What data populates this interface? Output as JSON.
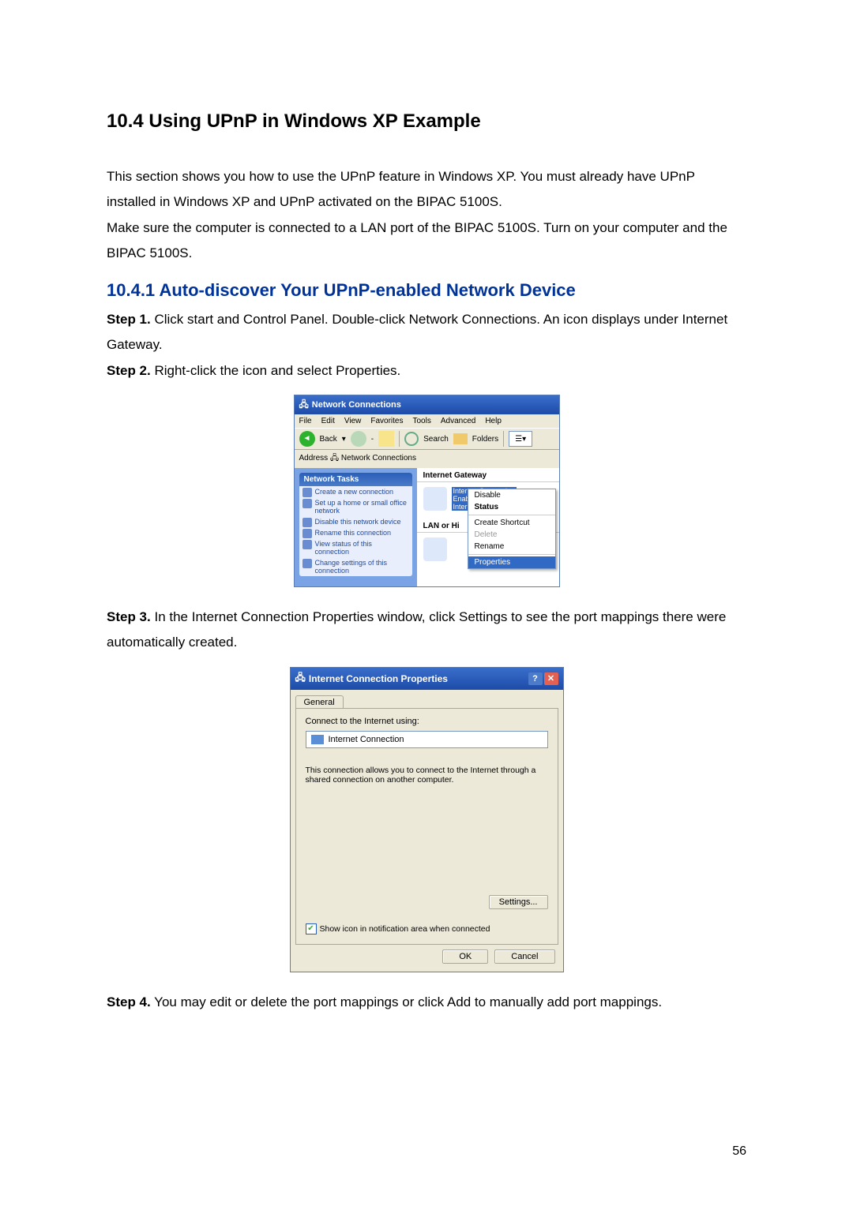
{
  "headings": {
    "h2": "10.4 Using UPnP in Windows XP Example",
    "h3": "10.4.1 Auto-discover Your UPnP-enabled Network Device"
  },
  "paragraphs": {
    "intro1": "This section shows you how to use the UPnP feature in Windows XP. You must already have UPnP installed in Windows XP and UPnP activated on the BIPAC 5100S.",
    "intro2": "Make sure the computer is connected to a LAN port of the BIPAC 5100S. Turn on your computer and the BIPAC 5100S."
  },
  "steps": {
    "s1_label": "Step 1.",
    "s1_text": " Click start and Control Panel. Double-click Network Connections. An icon displays under Internet Gateway.",
    "s2_label": "Step 2.",
    "s2_text": " Right-click the icon and select Properties.",
    "s3_label": "Step 3.",
    "s3_text": " In the Internet Connection Properties window, click Settings to see the port mappings there were automatically created.",
    "s4_label": "Step 4.",
    "s4_text": " You may edit or delete the port mappings or click Add to manually add port mappings."
  },
  "fig1": {
    "title": "Network Connections",
    "menu": {
      "file": "File",
      "edit": "Edit",
      "view": "View",
      "fav": "Favorites",
      "tools": "Tools",
      "adv": "Advanced",
      "help": "Help"
    },
    "toolbar": {
      "back": "Back",
      "search": "Search",
      "folders": "Folders"
    },
    "address_label": "Address",
    "address_value": "Network Connections",
    "tasks_header": "Network Tasks",
    "tasks": {
      "t1": "Create a new connection",
      "t2": "Set up a home or small office network",
      "t3": "Disable this network device",
      "t4": "Rename this connection",
      "t5": "View status of this connection",
      "t6": "Change settings of this connection"
    },
    "group1": "Internet Gateway",
    "conn1_line1": "Internet Connection",
    "conn1_line2": "Enabled",
    "conn1_line3": "Internet Connection",
    "group2": "LAN or Hi",
    "context_menu": {
      "disable": "Disable",
      "status": "Status",
      "shortcut": "Create Shortcut",
      "delete": "Delete",
      "rename": "Rename",
      "properties": "Properties"
    }
  },
  "fig2": {
    "title": "Internet Connection Properties",
    "tab": "General",
    "connect_using_label": "Connect to the Internet using:",
    "connect_using_value": "Internet Connection",
    "description": "This connection allows you to connect to the Internet through a shared connection on another computer.",
    "settings_btn": "Settings...",
    "checkbox_label": "Show icon in notification area when connected",
    "ok": "OK",
    "cancel": "Cancel"
  },
  "page_number": "56"
}
